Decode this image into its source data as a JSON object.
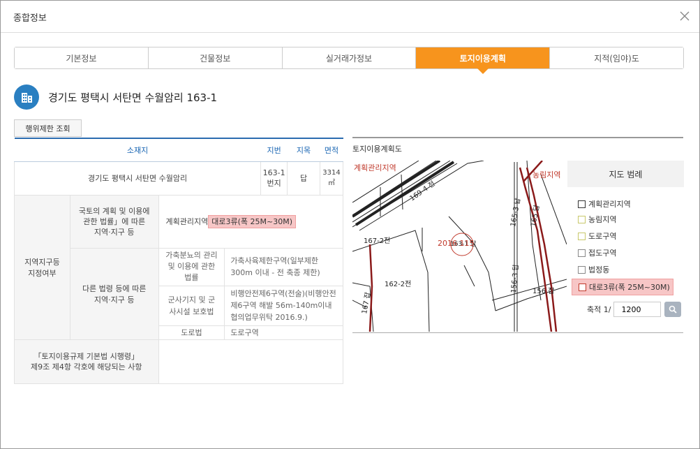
{
  "window": {
    "title": "종합정보"
  },
  "tabs": [
    {
      "label": "기본정보"
    },
    {
      "label": "건물정보"
    },
    {
      "label": "실거래가정보"
    },
    {
      "label": "토지이용계획"
    },
    {
      "label": "지적(임야)도"
    }
  ],
  "active_tab_index": 3,
  "address": "경기도 평택시 서탄면 수월암리 163-1",
  "action_button": "행위제한 조회",
  "table": {
    "headers": {
      "location": "소재지",
      "lot_no": "지번",
      "land_category": "지목",
      "area": "면적"
    },
    "row": {
      "location": "경기도 평택시 서탄면 수월암리",
      "lot_no": "163-1번지",
      "land_category": "답",
      "area": "3314㎡"
    },
    "zone_label": "지역지구등\n지정여부",
    "national_law_label": "국토의 계획 및 이용에\n관한 법률」에 따른\n지역·지구 등",
    "national_law_value": "계획관리지역",
    "national_law_highlight": "대로3류(폭 25M~30M)",
    "other_law_label": "다른 법령 등에 따른\n지역·지구 등",
    "other_laws": [
      {
        "law": "가축분뇨의 관리 및 이용에 관한 법률",
        "value": "가축사육제한구역(일부제한 300m 이내 - 전 축종 제한)"
      },
      {
        "law": "군사기지 및 군사시설 보호법",
        "value": "비행안전제6구역(전술)(비행안전제6구역 해발 56m-140m이내 협의업무위탁 2016.9.)"
      },
      {
        "law": "도로법",
        "value": "도로구역"
      }
    ],
    "enforcement_label": "「토지이용규제 기본법 시행령」 제9조 제4항 각호에 해당되는 사항"
  },
  "map": {
    "title": "토지이용계획도",
    "labels": [
      "계획관리지역",
      "농림지역",
      "169-4 전",
      "165-3 답",
      "165 답",
      "167-2전",
      "2016 115",
      "163-1 답",
      "162-2전",
      "156-3 답",
      "156 잡",
      "167 잡"
    ]
  },
  "legend": {
    "title": "지도 범례",
    "items": [
      {
        "label": "계획관리지역",
        "color": "#333333"
      },
      {
        "label": "농림지역",
        "color": "#c8c86a"
      },
      {
        "label": "도로구역",
        "color": "#c8c86a"
      },
      {
        "label": "접도구역",
        "color": "#888888"
      },
      {
        "label": "법정동",
        "color": "#888888"
      },
      {
        "label": "대로3류(폭 25M~30M)",
        "color": "#c0392b",
        "highlight": true
      }
    ],
    "scale_label": "축적 1/",
    "scale_value": "1200"
  },
  "colors": {
    "accent": "#f7941d",
    "primary": "#2b6cb0",
    "highlight": "#f7c6c6"
  }
}
